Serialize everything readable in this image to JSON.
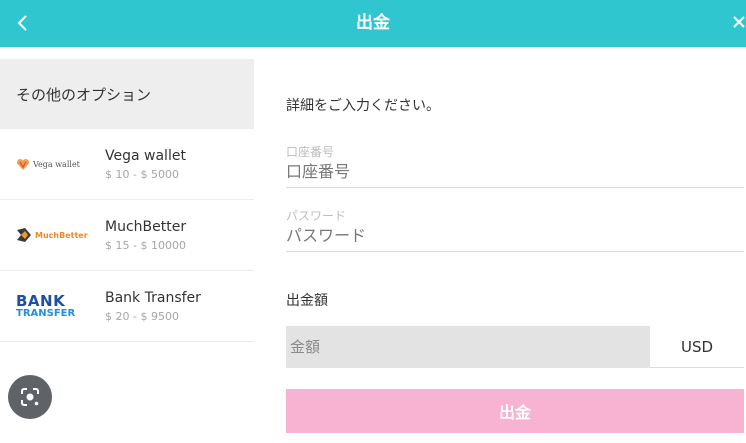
{
  "header": {
    "title": "出金",
    "back_icon": "chevron-left-icon",
    "close_icon": "close-icon"
  },
  "sidebar": {
    "title": "その他のオプション",
    "options": [
      {
        "logo_text": "Vega wallet",
        "name": "Vega wallet",
        "range": "$ 10 - $ 5000"
      },
      {
        "logo_text": "MuchBetter",
        "name": "MuchBetter",
        "range": "$ 15 - $ 10000"
      },
      {
        "logo_text_1": "BANK",
        "logo_text_2": "TRANSFER",
        "name": "Bank Transfer",
        "range": "$ 20 - $ 9500"
      }
    ]
  },
  "form": {
    "instruction": "詳細をご入力ください。",
    "account_label": "口座番号",
    "account_placeholder": "口座番号",
    "password_label": "パスワード",
    "password_placeholder": "パスワード",
    "amount_title": "出金額",
    "amount_placeholder": "金額",
    "currency": "USD",
    "submit_label": "出金"
  },
  "colors": {
    "header": "#2fc6cf",
    "submit": "#f8b3d3",
    "sidebar_head": "#eeeeee"
  }
}
